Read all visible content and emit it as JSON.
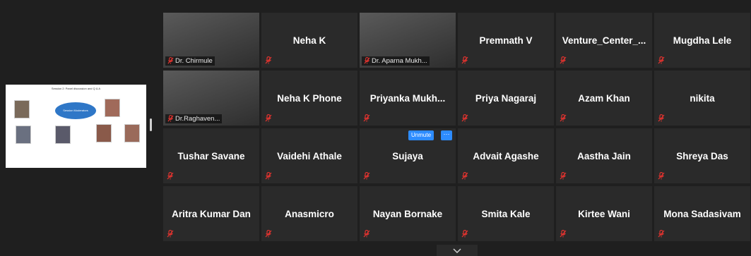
{
  "share": {
    "slide_title": "Session 2: Panel discussion and Q & A",
    "oval_text": "Session Moderators"
  },
  "controls": {
    "unmute_label": "Unmute",
    "more_label": "···"
  },
  "tiles": [
    {
      "name": "Dr. Chirmule",
      "video": true
    },
    {
      "name": "Neha K",
      "video": false
    },
    {
      "name": "Dr. Aparna Mukh...",
      "video": true,
      "active": true
    },
    {
      "name": "Premnath V",
      "video": false
    },
    {
      "name": "Venture_Center_...",
      "video": false
    },
    {
      "name": "Mugdha Lele",
      "video": false
    },
    {
      "name": "Dr.Raghaven...",
      "video": true
    },
    {
      "name": "Neha K Phone",
      "video": false
    },
    {
      "name": "Priyanka Mukh...",
      "video": false
    },
    {
      "name": "Priya Nagaraj",
      "video": false
    },
    {
      "name": "Azam Khan",
      "video": false
    },
    {
      "name": "nikita",
      "video": false
    },
    {
      "name": "Tushar Savane",
      "video": false
    },
    {
      "name": "Vaidehi Athale",
      "video": false
    },
    {
      "name": "Sujaya",
      "video": false
    },
    {
      "name": "Advait Agashe",
      "video": false
    },
    {
      "name": "Aastha Jain",
      "video": false
    },
    {
      "name": "Shreya Das",
      "video": false
    },
    {
      "name": "Aritra Kumar Dan",
      "video": false
    },
    {
      "name": "Anasmicro",
      "video": false
    },
    {
      "name": "Nayan Bornake",
      "video": false
    },
    {
      "name": "Smita Kale",
      "video": false
    },
    {
      "name": "Kirtee Wani",
      "video": false
    },
    {
      "name": "Mona Sadasivam",
      "video": false
    }
  ],
  "colors": {
    "active_border": "#c7d93f",
    "mic_muted": "#e0332f",
    "button_blue": "#2d8cff"
  },
  "icons": {
    "mic": "microphone-muted-icon",
    "chevron": "chevron-down-icon"
  }
}
